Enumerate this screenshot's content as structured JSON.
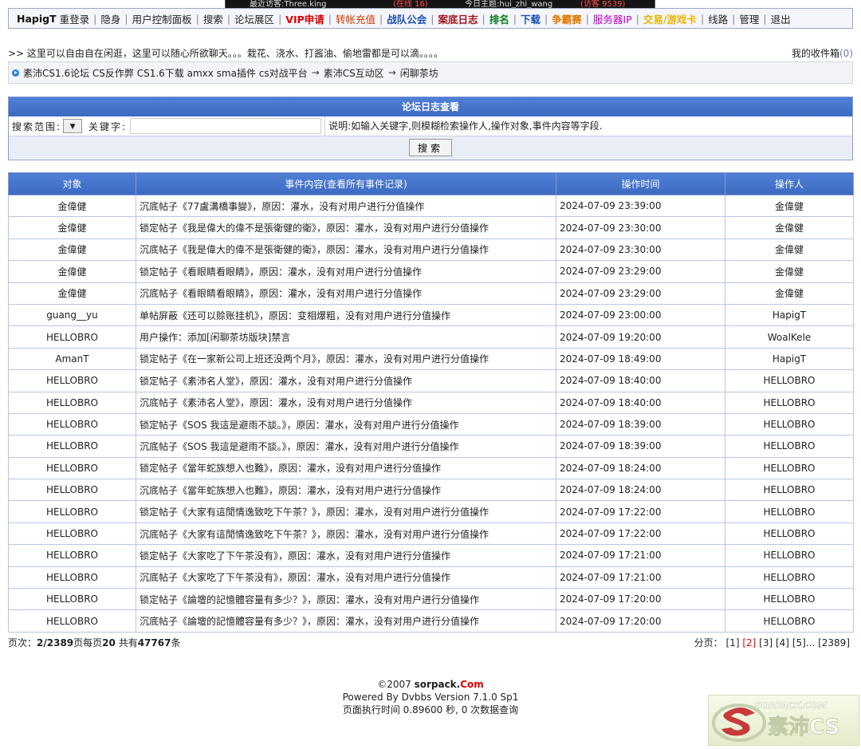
{
  "top_strip": {
    "frag1": "最近访客:Three.king",
    "frag2": "(在线 16)",
    "frag3": "今日主题:hui_zhi_wang",
    "frag4": "(访客 9539)"
  },
  "nav": {
    "user": "HapigT",
    "items": [
      "重登录",
      "隐身",
      "用户控制面板",
      "搜索",
      "论坛展区",
      "VIP申请",
      "转帐充值",
      "战队公会",
      "案底日志",
      "排名",
      "下载",
      "争霸赛",
      "服务器IP",
      "交易/游戏卡",
      "线路",
      "管理",
      "退出"
    ]
  },
  "intro": {
    "text": ">> 这里可以自由自在闲逛，这里可以随心所欲聊天。。。栽花、浇水、打酱油、偷地雷都是可以滴。。。。",
    "inbox_label": "我的收件箱",
    "inbox_count": "(0)"
  },
  "breadcrumb": [
    "素沛CS1.6论坛 CS反作弊 CS1.6下载 amxx sma插件 cs对战平台",
    "素沛CS互动区",
    "闲聊茶坊"
  ],
  "breadcrumb_sep": "→",
  "search": {
    "title": "论坛日志查看",
    "scope_label": "搜索范围:",
    "keyword_label": "关键字:",
    "keyword_value": "",
    "explain": "说明:如输入关键字,则模糊检索操作人,操作对象,事件内容等字段.",
    "button": "搜索",
    "dropdown_icon": "triangle-down"
  },
  "table": {
    "headers": [
      "对象",
      "事件内容(查看所有事件记录)",
      "操作时间",
      "操作人"
    ],
    "rows": [
      [
        "金偉健",
        "沉底帖子《77盧溝橋事變》，原因：灌水，没有对用户进行分值操作",
        "2024-07-09 23:39:00",
        "金偉健"
      ],
      [
        "金偉健",
        "锁定帖子《我是偉大的偉不是張衛健的衛》，原因：灌水，没有对用户进行分值操作",
        "2024-07-09 23:30:00",
        "金偉健"
      ],
      [
        "金偉健",
        "沉底帖子《我是偉大的偉不是張衛健的衛》，原因：灌水，没有对用户进行分值操作",
        "2024-07-09 23:30:00",
        "金偉健"
      ],
      [
        "金偉健",
        "锁定帖子《看眼睛看眼睛》，原因：灌水，没有对用户进行分值操作",
        "2024-07-09 23:29:00",
        "金偉健"
      ],
      [
        "金偉健",
        "沉底帖子《看眼睛看眼睛》，原因：灌水，没有对用户进行分值操作",
        "2024-07-09 23:29:00",
        "金偉健"
      ],
      [
        "guang__yu",
        "单帖屏蔽《还可以赊账挂机》，原因：变相爆粗，没有对用户进行分值操作",
        "2024-07-09 23:00:00",
        "HapigT"
      ],
      [
        "HELLOBRO",
        "用户操作：添加[闲聊茶坊版块]禁言",
        "2024-07-09 19:20:00",
        "WoalKele"
      ],
      [
        "AmanT",
        "锁定帖子《在一家新公司上班还没两个月》，原因：灌水，没有对用户进行分值操作",
        "2024-07-09 18:49:00",
        "HapigT"
      ],
      [
        "HELLOBRO",
        "锁定帖子《素沛名人堂》，原因：灌水，没有对用户进行分值操作",
        "2024-07-09 18:40:00",
        "HELLOBRO"
      ],
      [
        "HELLOBRO",
        "沉底帖子《素沛名人堂》，原因：灌水，没有对用户进行分值操作",
        "2024-07-09 18:40:00",
        "HELLOBRO"
      ],
      [
        "HELLOBRO",
        "锁定帖子《SOS 我這是避雨不談。》，原因：灌水，没有对用户进行分值操作",
        "2024-07-09 18:39:00",
        "HELLOBRO"
      ],
      [
        "HELLOBRO",
        "沉底帖子《SOS 我這是避雨不談。》，原因：灌水，没有对用户进行分值操作",
        "2024-07-09 18:39:00",
        "HELLOBRO"
      ],
      [
        "HELLOBRO",
        "锁定帖子《當年蛇族想入也難》，原因：灌水，没有对用户进行分值操作",
        "2024-07-09 18:24:00",
        "HELLOBRO"
      ],
      [
        "HELLOBRO",
        "沉底帖子《當年蛇族想入也難》，原因：灌水，没有对用户进行分值操作",
        "2024-07-09 18:24:00",
        "HELLOBRO"
      ],
      [
        "HELLOBRO",
        "锁定帖子《大家有這閒情逸致吃下午茶？》，原因：灌水，没有对用户进行分值操作",
        "2024-07-09 17:22:00",
        "HELLOBRO"
      ],
      [
        "HELLOBRO",
        "沉底帖子《大家有這閒情逸致吃下午茶？》，原因：灌水，没有对用户进行分值操作",
        "2024-07-09 17:22:00",
        "HELLOBRO"
      ],
      [
        "HELLOBRO",
        "锁定帖子《大家吃了下午茶没有》，原因：灌水，没有对用户进行分值操作",
        "2024-07-09 17:21:00",
        "HELLOBRO"
      ],
      [
        "HELLOBRO",
        "沉底帖子《大家吃了下午茶没有》，原因：灌水，没有对用户进行分值操作",
        "2024-07-09 17:21:00",
        "HELLOBRO"
      ],
      [
        "HELLOBRO",
        "锁定帖子《論壇的記憶體容量有多少？》，原因：灌水，没有对用户进行分值操作",
        "2024-07-09 17:20:00",
        "HELLOBRO"
      ],
      [
        "HELLOBRO",
        "沉底帖子《論壇的記憶體容量有多少？》，原因：灌水，没有对用户进行分值操作",
        "2024-07-09 17:20:00",
        "HELLOBRO"
      ]
    ]
  },
  "pagination": {
    "label": "页次：",
    "page": "2/2389",
    "per_page_label": "页每页",
    "per_page": "20",
    "total_label": " 共有",
    "total": "47767",
    "unit": "条",
    "right_label": "分页：",
    "pages": [
      "[1]",
      "[2]",
      "[3]",
      "[4]",
      "[5]...",
      "[2389]"
    ],
    "current_index": 1
  },
  "footer": {
    "copyright": "©2007",
    "site": "sorpack.",
    "site_com": "Com",
    "powered": "Powered By Dvbbs Version 7.1.0 Sp1",
    "exec": "页面执行时间 0.89600 秒, 0 次数据查询"
  },
  "logo": {
    "text_top": "SORPACK.COM",
    "text_main": "素沛CS"
  },
  "colors": {
    "header_blue": "#4470c8",
    "vip_red": "#e00000",
    "link_blue": "#1c4fb0"
  }
}
